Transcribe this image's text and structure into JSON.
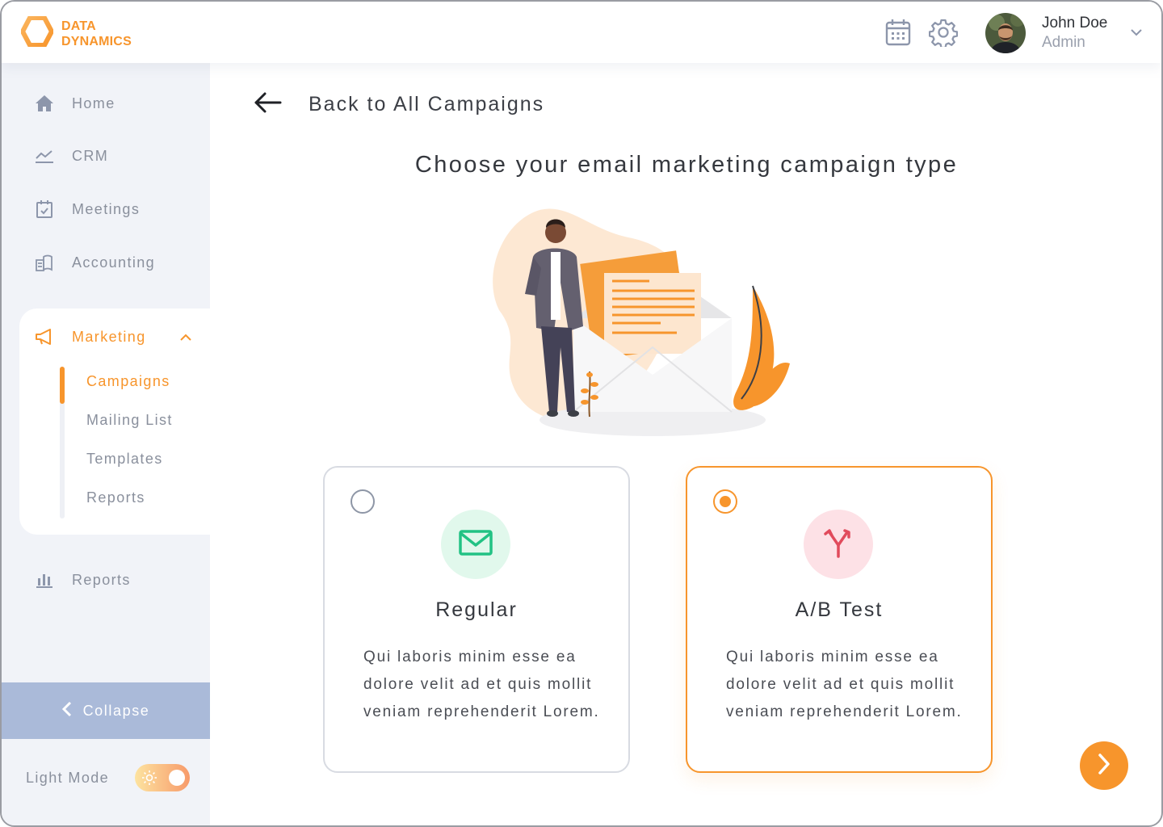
{
  "brand": {
    "line1": "DATA",
    "line2": "DYNAMICS",
    "accent": "#f7952c"
  },
  "header": {
    "calendar_icon": "calendar-icon",
    "settings_icon": "gear-icon",
    "user": {
      "name": "John Doe",
      "role": "Admin"
    }
  },
  "sidebar": {
    "items": [
      {
        "label": "Home",
        "icon": "home-icon"
      },
      {
        "label": "CRM",
        "icon": "chart-line-icon"
      },
      {
        "label": "Meetings",
        "icon": "calendar-check-icon"
      },
      {
        "label": "Accounting",
        "icon": "accounting-icon"
      }
    ],
    "marketing": {
      "label": "Marketing",
      "icon": "megaphone-icon",
      "expanded": true,
      "subitems": [
        {
          "label": "Campaigns",
          "active": true
        },
        {
          "label": "Mailing List",
          "active": false
        },
        {
          "label": "Templates",
          "active": false
        },
        {
          "label": "Reports",
          "active": false
        }
      ]
    },
    "reports": {
      "label": "Reports",
      "icon": "bar-chart-icon"
    },
    "collapse_label": "Collapse",
    "light_mode_label": "Light Mode",
    "light_mode_on": true
  },
  "main": {
    "back_label": "Back to All Campaigns",
    "title": "Choose your email marketing campaign type",
    "options": [
      {
        "title": "Regular",
        "description": "Qui laboris minim esse ea dolore velit ad et quis mollit veniam reprehenderit Lorem.",
        "icon": "envelope-icon",
        "icon_bg": "#e1f8ec",
        "icon_color": "#22c284",
        "selected": false
      },
      {
        "title": "A/B Test",
        "description": "Qui laboris minim esse ea dolore velit ad et quis mollit veniam reprehenderit Lorem.",
        "icon": "split-arrows-icon",
        "icon_bg": "#fde1e6",
        "icon_color": "#e14b5c",
        "selected": true
      }
    ],
    "next_icon": "chevron-right-icon"
  }
}
